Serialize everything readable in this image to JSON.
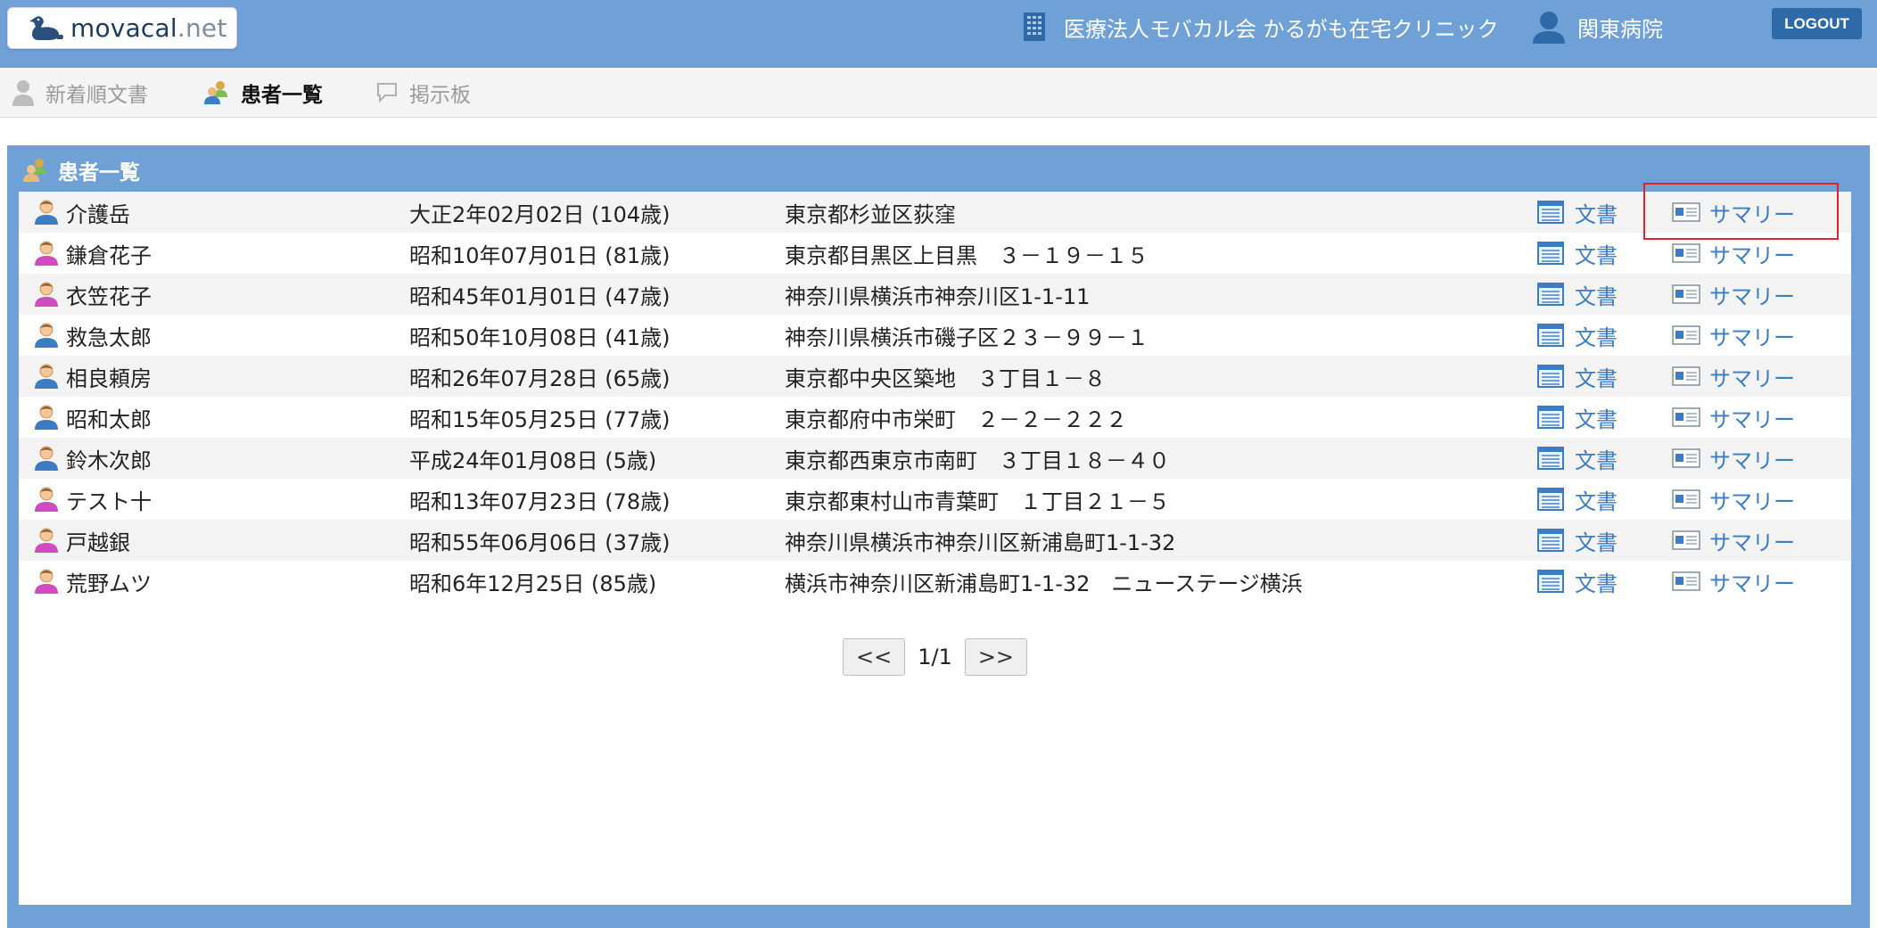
{
  "header": {
    "logo_main": "movacal",
    "logo_suffix": ".net",
    "organization": "医療法人モバカル会 かるがも在宅クリニック",
    "user": "関東病院",
    "logout_label": "LOGOUT"
  },
  "nav": {
    "items": [
      {
        "label": "新着順文書",
        "icon": "user-doc-icon"
      },
      {
        "label": "患者一覧",
        "icon": "patients-icon"
      },
      {
        "label": "掲示板",
        "icon": "speech-bubble-icon"
      }
    ],
    "active": "患者一覧"
  },
  "panel": {
    "title": "患者一覧",
    "doc_label": "文書",
    "summary_label": "サマリー",
    "patients": [
      {
        "name": "介護岳",
        "gender": "male",
        "birth": "大正2年02月02日 (104歳)",
        "address": "東京都杉並区荻窪"
      },
      {
        "name": "鎌倉花子",
        "gender": "female",
        "birth": "昭和10年07月01日 (81歳)",
        "address": "東京都目黒区上目黒　３－１９－１５"
      },
      {
        "name": "衣笠花子",
        "gender": "female",
        "birth": "昭和45年01月01日 (47歳)",
        "address": "神奈川県横浜市神奈川区1-1-11"
      },
      {
        "name": "救急太郎",
        "gender": "male",
        "birth": "昭和50年10月08日 (41歳)",
        "address": "神奈川県横浜市磯子区２３－９９－１"
      },
      {
        "name": "相良頼房",
        "gender": "male",
        "birth": "昭和26年07月28日 (65歳)",
        "address": "東京都中央区築地　３丁目１－８"
      },
      {
        "name": "昭和太郎",
        "gender": "male",
        "birth": "昭和15年05月25日 (77歳)",
        "address": "東京都府中市栄町　２－２－２２２"
      },
      {
        "name": "鈴木次郎",
        "gender": "male",
        "birth": "平成24年01月08日 (5歳)",
        "address": "東京都西東京市南町　３丁目１８－４０"
      },
      {
        "name": "テスト十",
        "gender": "female",
        "birth": "昭和13年07月23日 (78歳)",
        "address": "東京都東村山市青葉町　１丁目２１－５"
      },
      {
        "name": "戸越銀",
        "gender": "female",
        "birth": "昭和55年06月06日 (37歳)",
        "address": "神奈川県横浜市神奈川区新浦島町1-1-32"
      },
      {
        "name": "荒野ムツ",
        "gender": "female",
        "birth": "昭和6年12月25日 (85歳)",
        "address": "横浜市神奈川区新浦島町1-1-32　ニューステージ横浜"
      }
    ]
  },
  "pager": {
    "prev": "<<",
    "page": "1/1",
    "next": ">>"
  },
  "colors": {
    "header": "#6fa0d6",
    "link": "#3b7cc4",
    "logout": "#2e6aa8",
    "highlight": "#e0242c"
  }
}
